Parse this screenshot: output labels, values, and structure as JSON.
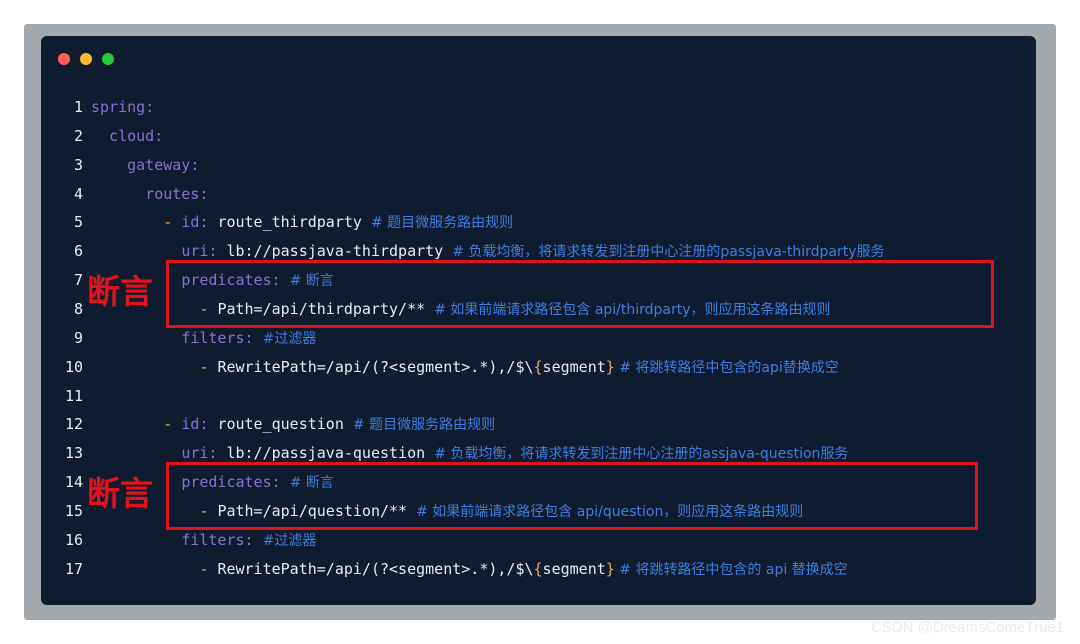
{
  "window": {
    "controls": [
      "close",
      "minimize",
      "maximize"
    ]
  },
  "code": {
    "lines": [
      {
        "n": "1",
        "indent": "",
        "key": "spring",
        "colon": ":"
      },
      {
        "n": "2",
        "indent": "  ",
        "key": "cloud",
        "colon": ":"
      },
      {
        "n": "3",
        "indent": "    ",
        "key": "gateway",
        "colon": ":"
      },
      {
        "n": "4",
        "indent": "      ",
        "key": "routes",
        "colon": ":"
      },
      {
        "n": "5",
        "indent": "        ",
        "dash": "- ",
        "key": "id",
        "colon": ": ",
        "value": "route_thirdparty ",
        "comment": "# 题目微服务路由规则"
      },
      {
        "n": "6",
        "indent": "          ",
        "key": "uri",
        "colon": ": ",
        "value": "lb://passjava-thirdparty ",
        "comment": "# 负载均衡，将请求转发到注册中心注册的passjava-thirdparty服务"
      },
      {
        "n": "7",
        "indent": "          ",
        "key": "predicates",
        "colon": ": ",
        "comment": "# 断言"
      },
      {
        "n": "8",
        "indent": "            ",
        "dash": "- ",
        "value": "Path=/api/thirdparty/** ",
        "comment": "# 如果前端请求路径包含 api/thirdparty，则应用这条路由规则"
      },
      {
        "n": "9",
        "indent": "          ",
        "key": "filters",
        "colon": ": ",
        "comment": "#过滤器"
      },
      {
        "n": "10",
        "indent": "            ",
        "dash": "- ",
        "value": "RewritePath=/api/(?<segment>.*),/$\\",
        "brace_open": "{",
        "value2": "segment",
        "brace_close": "}",
        "comment": " # 将跳转路径中包含的api替换成空"
      },
      {
        "n": "11",
        "indent": ""
      },
      {
        "n": "12",
        "indent": "        ",
        "dash": "- ",
        "key": "id",
        "colon": ": ",
        "value": "route_question ",
        "comment": "# 题目微服务路由规则"
      },
      {
        "n": "13",
        "indent": "          ",
        "key": "uri",
        "colon": ": ",
        "value": "lb://passjava-question ",
        "comment": "# 负载均衡，将请求转发到注册中心注册的assjava-question服务"
      },
      {
        "n": "14",
        "indent": "          ",
        "key": "predicates",
        "colon": ": ",
        "comment": "# 断言"
      },
      {
        "n": "15",
        "indent": "            ",
        "dash": "- ",
        "value": "Path=/api/question/** ",
        "comment": "# 如果前端请求路径包含 api/question，则应用这条路由规则"
      },
      {
        "n": "16",
        "indent": "          ",
        "key": "filters",
        "colon": ": ",
        "comment": "#过滤器"
      },
      {
        "n": "17",
        "indent": "            ",
        "dash": "- ",
        "value": "RewritePath=/api/(?<segment>.*),/$\\",
        "brace_open": "{",
        "value2": "segment",
        "brace_close": "}",
        "comment": " # 将跳转路径中包含的 api 替换成空"
      }
    ]
  },
  "annotations": [
    {
      "label": "断言"
    },
    {
      "label": "断言"
    }
  ],
  "watermark": "CSDN @DreamsComeTrue1",
  "colors": {
    "background": "#0f1b2e",
    "key": "#8a6fd0",
    "comment": "#3d7ee0",
    "dash": "#f0a35a",
    "highlight": "#e0121b"
  }
}
